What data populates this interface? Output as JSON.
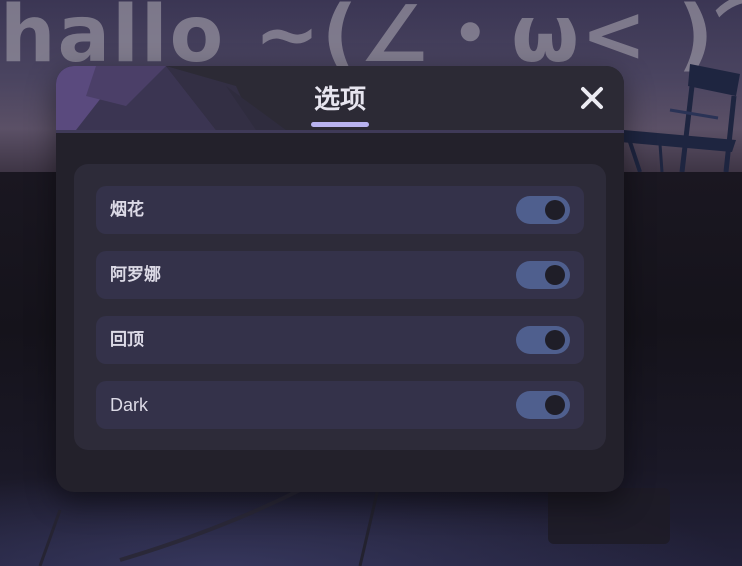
{
  "background": {
    "banner_text": "hallo ~(∠・ω< )⌒"
  },
  "dialog": {
    "title": "选项",
    "close_icon": "close-icon",
    "options": [
      {
        "label": "烟花",
        "enabled": true
      },
      {
        "label": "阿罗娜",
        "enabled": true
      },
      {
        "label": "回顶",
        "enabled": true
      },
      {
        "label": "Dark",
        "enabled": true
      }
    ]
  },
  "colors": {
    "dialog_bg": "#23212b",
    "header_bg": "#2c2a35",
    "title_underline": "#b9b3f0",
    "toggle_on": "#4f5f8e",
    "toggle_knob": "#1f1e28",
    "row_bg": "#34324a"
  }
}
